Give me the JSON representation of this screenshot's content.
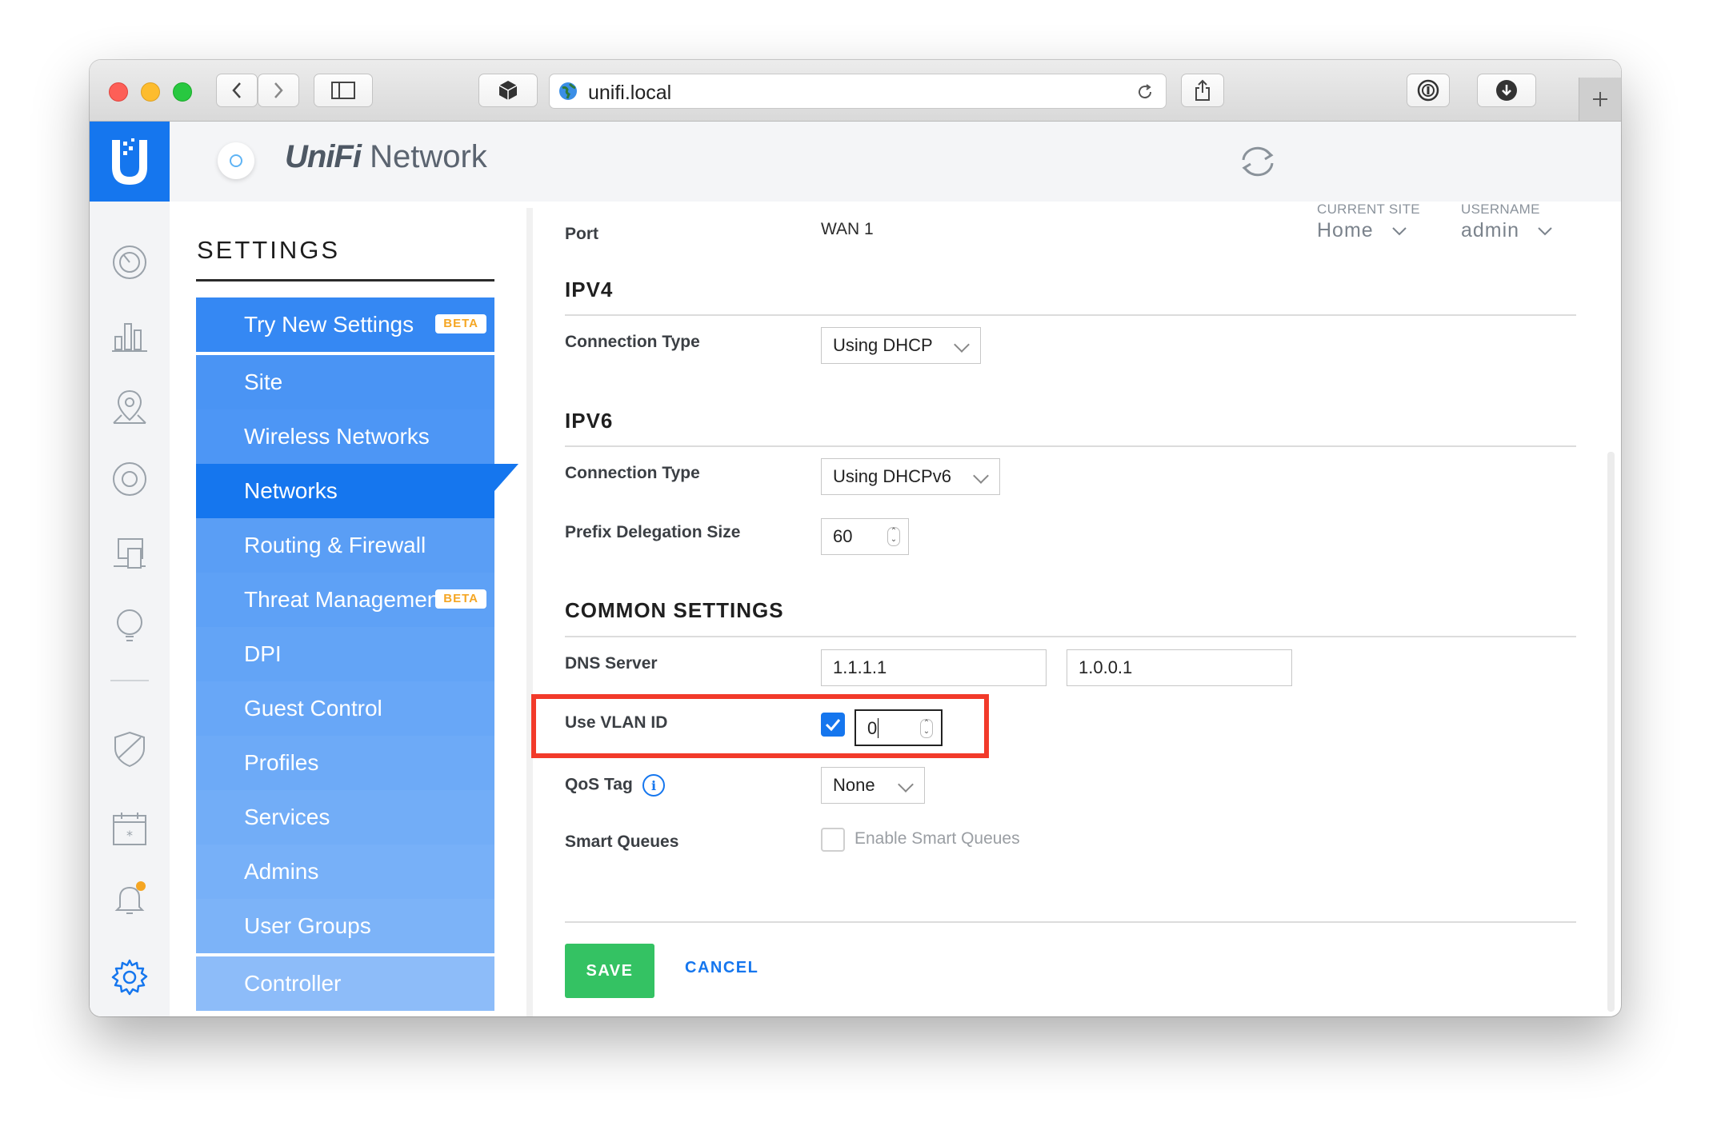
{
  "browser": {
    "url": "unifi.local"
  },
  "header": {
    "brand_logo": "UniFi",
    "brand_name": "Network",
    "current_site_label": "CURRENT SITE",
    "current_site_value": "Home",
    "username_label": "USERNAME",
    "username_value": "admin"
  },
  "sidebar": {
    "title": "SETTINGS",
    "items": [
      {
        "label": "Try New Settings",
        "badge": "BETA"
      },
      {
        "label": "Site"
      },
      {
        "label": "Wireless Networks"
      },
      {
        "label": "Networks",
        "active": true
      },
      {
        "label": "Routing & Firewall"
      },
      {
        "label": "Threat Management",
        "badge": "BETA"
      },
      {
        "label": "DPI"
      },
      {
        "label": "Guest Control"
      },
      {
        "label": "Profiles"
      },
      {
        "label": "Services"
      },
      {
        "label": "Admins"
      },
      {
        "label": "User Groups"
      },
      {
        "label": "Controller"
      }
    ]
  },
  "form": {
    "port_label": "Port",
    "port_value": "WAN 1",
    "ipv4_title": "IPV4",
    "ipv4_conn_label": "Connection Type",
    "ipv4_conn_value": "Using DHCP",
    "ipv6_title": "IPV6",
    "ipv6_conn_label": "Connection Type",
    "ipv6_conn_value": "Using DHCPv6",
    "prefix_label": "Prefix Delegation Size",
    "prefix_value": "60",
    "common_title": "COMMON SETTINGS",
    "dns_label": "DNS Server",
    "dns1": "1.1.1.1",
    "dns2": "1.0.0.1",
    "vlan_label": "Use VLAN ID",
    "vlan_checked": true,
    "vlan_value": "0",
    "qos_label": "QoS Tag",
    "qos_value": "None",
    "smart_label": "Smart Queues",
    "smart_checkbox_label": "Enable Smart Queues",
    "smart_checked": false
  },
  "actions": {
    "save": "SAVE",
    "cancel": "CANCEL"
  },
  "colors": {
    "accent": "#1576ee",
    "save_green": "#34c263",
    "highlight_red": "#f23a2a",
    "notification_orange": "#f5a623"
  }
}
